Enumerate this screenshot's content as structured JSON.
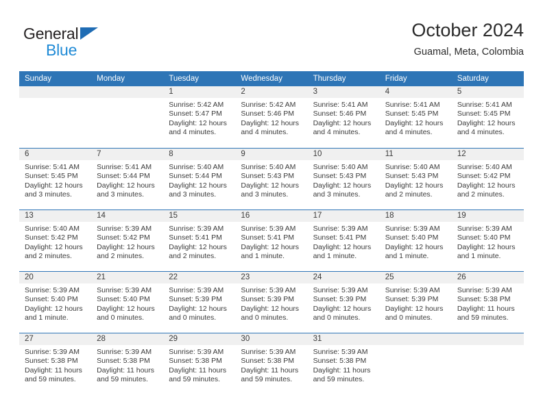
{
  "brand": {
    "line1": "General",
    "line2": "Blue",
    "triangle_icon": "triangle-logo-icon",
    "color_dark": "#231f20",
    "color_blue": "#1f8ad6",
    "color_triangle": "#1f6cb4"
  },
  "header": {
    "title": "October 2024",
    "subtitle": "Guamal, Meta, Colombia"
  },
  "theme": {
    "header_blue": "#2e75b6",
    "daynum_band": "#f0f0f0",
    "text": "#3a3a3a"
  },
  "weekdays": [
    "Sunday",
    "Monday",
    "Tuesday",
    "Wednesday",
    "Thursday",
    "Friday",
    "Saturday"
  ],
  "weeks": [
    [
      {
        "day": ""
      },
      {
        "day": ""
      },
      {
        "day": "1",
        "sunrise": "Sunrise: 5:42 AM",
        "sunset": "Sunset: 5:47 PM",
        "daylight_1": "Daylight: 12 hours",
        "daylight_2": "and 4 minutes."
      },
      {
        "day": "2",
        "sunrise": "Sunrise: 5:42 AM",
        "sunset": "Sunset: 5:46 PM",
        "daylight_1": "Daylight: 12 hours",
        "daylight_2": "and 4 minutes."
      },
      {
        "day": "3",
        "sunrise": "Sunrise: 5:41 AM",
        "sunset": "Sunset: 5:46 PM",
        "daylight_1": "Daylight: 12 hours",
        "daylight_2": "and 4 minutes."
      },
      {
        "day": "4",
        "sunrise": "Sunrise: 5:41 AM",
        "sunset": "Sunset: 5:45 PM",
        "daylight_1": "Daylight: 12 hours",
        "daylight_2": "and 4 minutes."
      },
      {
        "day": "5",
        "sunrise": "Sunrise: 5:41 AM",
        "sunset": "Sunset: 5:45 PM",
        "daylight_1": "Daylight: 12 hours",
        "daylight_2": "and 4 minutes."
      }
    ],
    [
      {
        "day": "6",
        "sunrise": "Sunrise: 5:41 AM",
        "sunset": "Sunset: 5:45 PM",
        "daylight_1": "Daylight: 12 hours",
        "daylight_2": "and 3 minutes."
      },
      {
        "day": "7",
        "sunrise": "Sunrise: 5:41 AM",
        "sunset": "Sunset: 5:44 PM",
        "daylight_1": "Daylight: 12 hours",
        "daylight_2": "and 3 minutes."
      },
      {
        "day": "8",
        "sunrise": "Sunrise: 5:40 AM",
        "sunset": "Sunset: 5:44 PM",
        "daylight_1": "Daylight: 12 hours",
        "daylight_2": "and 3 minutes."
      },
      {
        "day": "9",
        "sunrise": "Sunrise: 5:40 AM",
        "sunset": "Sunset: 5:43 PM",
        "daylight_1": "Daylight: 12 hours",
        "daylight_2": "and 3 minutes."
      },
      {
        "day": "10",
        "sunrise": "Sunrise: 5:40 AM",
        "sunset": "Sunset: 5:43 PM",
        "daylight_1": "Daylight: 12 hours",
        "daylight_2": "and 3 minutes."
      },
      {
        "day": "11",
        "sunrise": "Sunrise: 5:40 AM",
        "sunset": "Sunset: 5:43 PM",
        "daylight_1": "Daylight: 12 hours",
        "daylight_2": "and 2 minutes."
      },
      {
        "day": "12",
        "sunrise": "Sunrise: 5:40 AM",
        "sunset": "Sunset: 5:42 PM",
        "daylight_1": "Daylight: 12 hours",
        "daylight_2": "and 2 minutes."
      }
    ],
    [
      {
        "day": "13",
        "sunrise": "Sunrise: 5:40 AM",
        "sunset": "Sunset: 5:42 PM",
        "daylight_1": "Daylight: 12 hours",
        "daylight_2": "and 2 minutes."
      },
      {
        "day": "14",
        "sunrise": "Sunrise: 5:39 AM",
        "sunset": "Sunset: 5:42 PM",
        "daylight_1": "Daylight: 12 hours",
        "daylight_2": "and 2 minutes."
      },
      {
        "day": "15",
        "sunrise": "Sunrise: 5:39 AM",
        "sunset": "Sunset: 5:41 PM",
        "daylight_1": "Daylight: 12 hours",
        "daylight_2": "and 2 minutes."
      },
      {
        "day": "16",
        "sunrise": "Sunrise: 5:39 AM",
        "sunset": "Sunset: 5:41 PM",
        "daylight_1": "Daylight: 12 hours",
        "daylight_2": "and 1 minute."
      },
      {
        "day": "17",
        "sunrise": "Sunrise: 5:39 AM",
        "sunset": "Sunset: 5:41 PM",
        "daylight_1": "Daylight: 12 hours",
        "daylight_2": "and 1 minute."
      },
      {
        "day": "18",
        "sunrise": "Sunrise: 5:39 AM",
        "sunset": "Sunset: 5:40 PM",
        "daylight_1": "Daylight: 12 hours",
        "daylight_2": "and 1 minute."
      },
      {
        "day": "19",
        "sunrise": "Sunrise: 5:39 AM",
        "sunset": "Sunset: 5:40 PM",
        "daylight_1": "Daylight: 12 hours",
        "daylight_2": "and 1 minute."
      }
    ],
    [
      {
        "day": "20",
        "sunrise": "Sunrise: 5:39 AM",
        "sunset": "Sunset: 5:40 PM",
        "daylight_1": "Daylight: 12 hours",
        "daylight_2": "and 1 minute."
      },
      {
        "day": "21",
        "sunrise": "Sunrise: 5:39 AM",
        "sunset": "Sunset: 5:40 PM",
        "daylight_1": "Daylight: 12 hours",
        "daylight_2": "and 0 minutes."
      },
      {
        "day": "22",
        "sunrise": "Sunrise: 5:39 AM",
        "sunset": "Sunset: 5:39 PM",
        "daylight_1": "Daylight: 12 hours",
        "daylight_2": "and 0 minutes."
      },
      {
        "day": "23",
        "sunrise": "Sunrise: 5:39 AM",
        "sunset": "Sunset: 5:39 PM",
        "daylight_1": "Daylight: 12 hours",
        "daylight_2": "and 0 minutes."
      },
      {
        "day": "24",
        "sunrise": "Sunrise: 5:39 AM",
        "sunset": "Sunset: 5:39 PM",
        "daylight_1": "Daylight: 12 hours",
        "daylight_2": "and 0 minutes."
      },
      {
        "day": "25",
        "sunrise": "Sunrise: 5:39 AM",
        "sunset": "Sunset: 5:39 PM",
        "daylight_1": "Daylight: 12 hours",
        "daylight_2": "and 0 minutes."
      },
      {
        "day": "26",
        "sunrise": "Sunrise: 5:39 AM",
        "sunset": "Sunset: 5:38 PM",
        "daylight_1": "Daylight: 11 hours",
        "daylight_2": "and 59 minutes."
      }
    ],
    [
      {
        "day": "27",
        "sunrise": "Sunrise: 5:39 AM",
        "sunset": "Sunset: 5:38 PM",
        "daylight_1": "Daylight: 11 hours",
        "daylight_2": "and 59 minutes."
      },
      {
        "day": "28",
        "sunrise": "Sunrise: 5:39 AM",
        "sunset": "Sunset: 5:38 PM",
        "daylight_1": "Daylight: 11 hours",
        "daylight_2": "and 59 minutes."
      },
      {
        "day": "29",
        "sunrise": "Sunrise: 5:39 AM",
        "sunset": "Sunset: 5:38 PM",
        "daylight_1": "Daylight: 11 hours",
        "daylight_2": "and 59 minutes."
      },
      {
        "day": "30",
        "sunrise": "Sunrise: 5:39 AM",
        "sunset": "Sunset: 5:38 PM",
        "daylight_1": "Daylight: 11 hours",
        "daylight_2": "and 59 minutes."
      },
      {
        "day": "31",
        "sunrise": "Sunrise: 5:39 AM",
        "sunset": "Sunset: 5:38 PM",
        "daylight_1": "Daylight: 11 hours",
        "daylight_2": "and 59 minutes."
      },
      {
        "day": ""
      },
      {
        "day": ""
      }
    ]
  ]
}
